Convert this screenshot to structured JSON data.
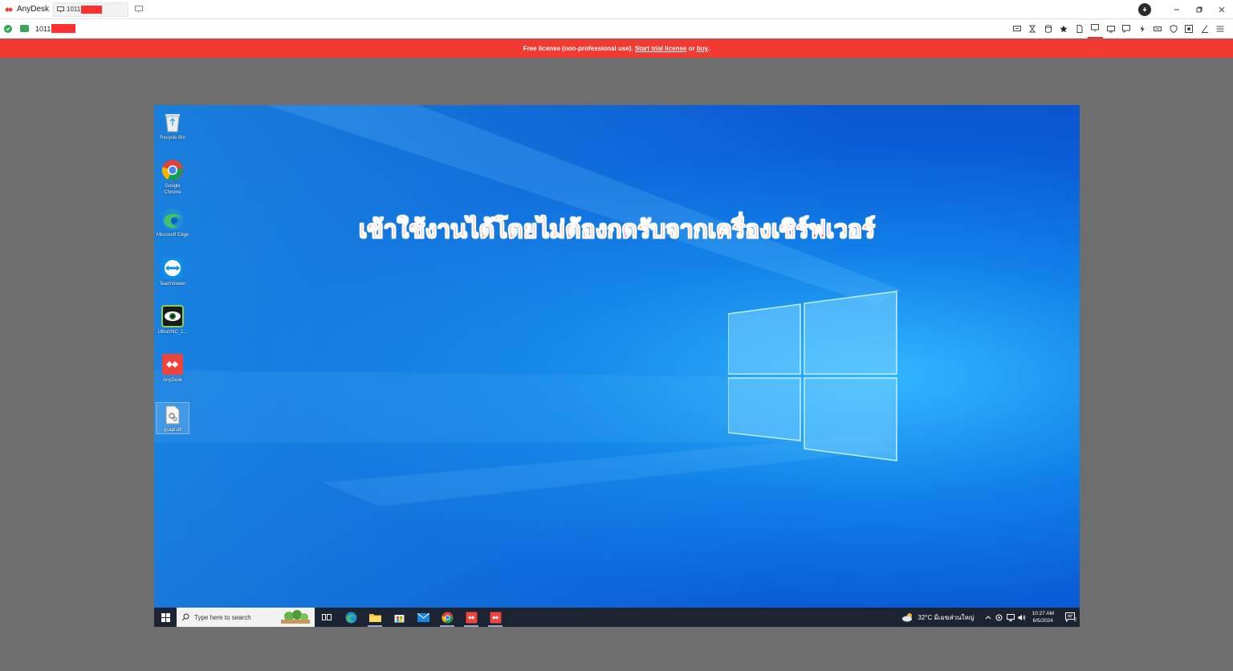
{
  "titlebar": {
    "app_name": "AnyDesk",
    "tab_label": "1011",
    "icons": [
      "anydesk-logo-icon",
      "monitor-icon",
      "new-tab-icon",
      "download-icon",
      "minimize-icon",
      "restore-icon",
      "close-icon"
    ]
  },
  "addressbar": {
    "value": "1011",
    "toolbar_icons": [
      "display-icon",
      "hourglass-icon",
      "database-icon",
      "star-icon",
      "file-icon",
      "monitor-icon",
      "window-icon",
      "chat-icon",
      "lightning-icon",
      "keyboard-icon",
      "shield-icon",
      "record-icon",
      "pen-icon",
      "menu-icon"
    ]
  },
  "banner": {
    "text": "Free license (non-professional use).",
    "link_trial": "Start trial license",
    "or": "or",
    "link_buy": "buy",
    "period": "."
  },
  "remote": {
    "headline": "เข้าใช้งานได้โดยไม่ต้องกดรับจากเครื่องเซิร์ฟเวอร์",
    "desktop_icons": [
      {
        "label": "Recycle Bin",
        "icon": "recycle-bin-icon"
      },
      {
        "label": "Google Chrome",
        "icon": "chrome-icon"
      },
      {
        "label": "Microsoft Edge",
        "icon": "edge-icon"
      },
      {
        "label": "TeamViewer",
        "icon": "teamviewer-icon"
      },
      {
        "label": "UltraVNC_1...",
        "icon": "ultravnc-icon"
      },
      {
        "label": "AnyDesk",
        "icon": "anydesk-icon"
      },
      {
        "label": "gcapi.dll",
        "icon": "dll-file-icon"
      }
    ],
    "taskbar": {
      "search_placeholder": "Type here to search",
      "weather": "32°C มีเมฆส่วนใหญ่",
      "time": "10:27 AM",
      "date": "6/5/2024",
      "notification_count": "2"
    }
  },
  "colors": {
    "accent_red": "#f23a33",
    "desktop_blue": "#0a6fe0",
    "taskbar": "#1c2333"
  }
}
